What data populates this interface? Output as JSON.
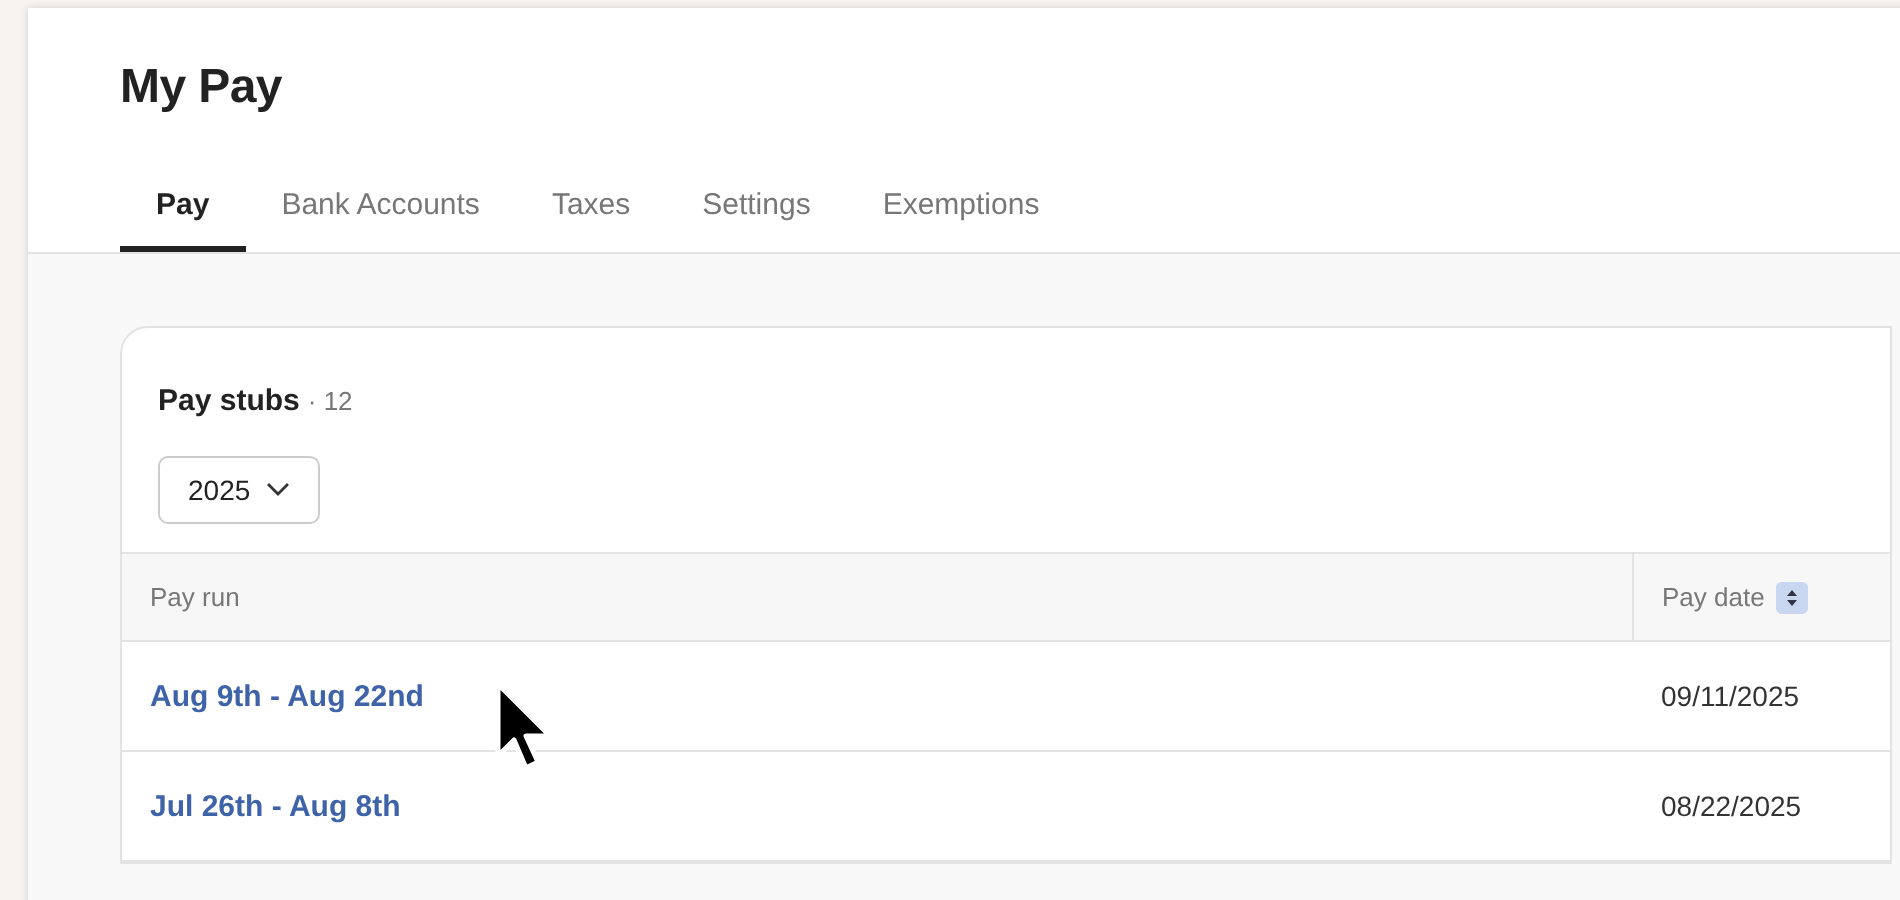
{
  "page": {
    "title": "My Pay"
  },
  "tabs": [
    {
      "label": "Pay",
      "selected": true
    },
    {
      "label": "Bank Accounts",
      "selected": false
    },
    {
      "label": "Taxes",
      "selected": false
    },
    {
      "label": "Settings",
      "selected": false
    },
    {
      "label": "Exemptions",
      "selected": false
    }
  ],
  "card": {
    "title": "Pay stubs",
    "count": "· 12",
    "year_select": {
      "value": "2025"
    },
    "table": {
      "columns": [
        "Pay run",
        "Pay date"
      ],
      "rows": [
        {
          "pay_run": "Aug 9th - Aug 22nd",
          "pay_date": "09/11/2025"
        },
        {
          "pay_run": "Jul 26th - Aug 8th",
          "pay_date": "08/22/2025"
        }
      ]
    }
  }
}
